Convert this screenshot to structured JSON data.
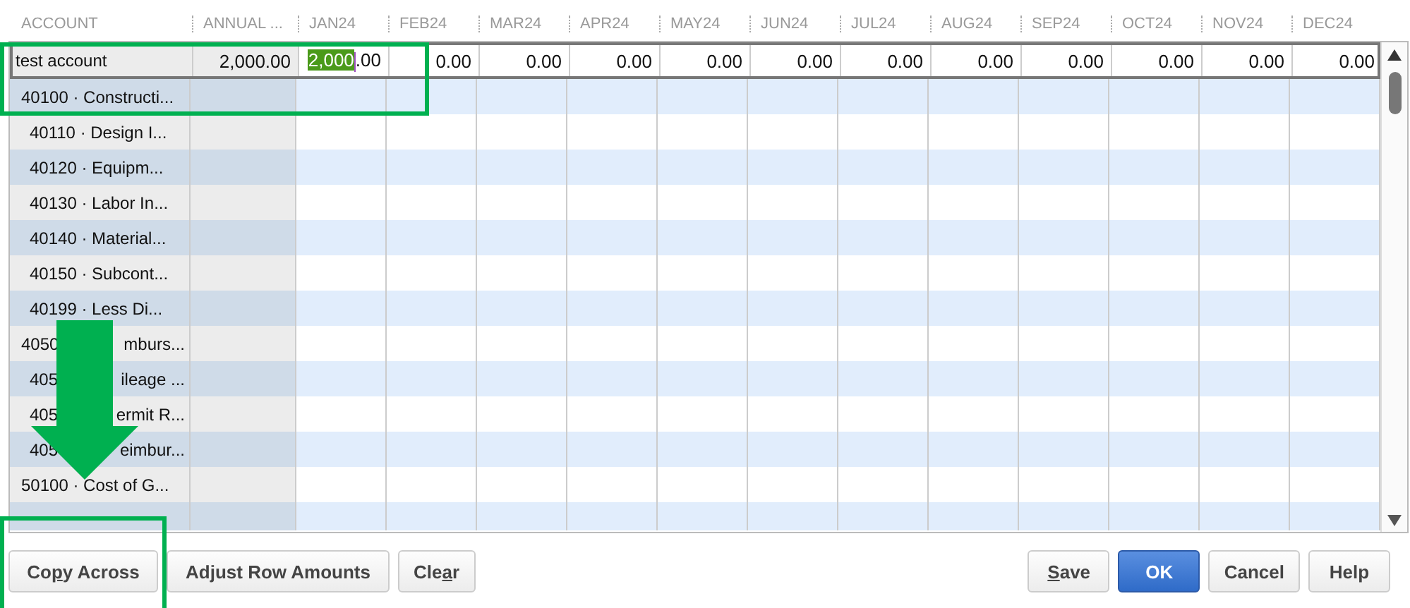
{
  "columns": [
    "ACCOUNT",
    "ANNUAL ...",
    "JAN24",
    "FEB24",
    "MAR24",
    "APR24",
    "MAY24",
    "JUN24",
    "JUL24",
    "AUG24",
    "SEP24",
    "OCT24",
    "NOV24",
    "DEC24"
  ],
  "entry_row": {
    "account": "test account",
    "annual": "2,000.00",
    "months": [
      {
        "highlighted": "2,000",
        "value": ".00"
      },
      {
        "value": "0.00"
      },
      {
        "value": "0.00"
      },
      {
        "value": "0.00"
      },
      {
        "value": "0.00"
      },
      {
        "value": "0.00"
      },
      {
        "value": "0.00"
      },
      {
        "value": "0.00"
      },
      {
        "value": "0.00"
      },
      {
        "value": "0.00"
      },
      {
        "value": "0.00"
      },
      {
        "value": "0.00"
      }
    ]
  },
  "accounts": [
    {
      "account": [
        "40100 · Constructi..."
      ],
      "children": [
        {
          "account": [
            "40110 · Design I..."
          ]
        },
        {
          "account": [
            "40120 · Equipm..."
          ]
        },
        {
          "account": [
            "40130 · Labor In..."
          ]
        },
        {
          "account": [
            "40140 · Material..."
          ]
        },
        {
          "account": [
            "40150 · Subcont..."
          ]
        },
        {
          "account": [
            "40199 · Less Di..."
          ]
        }
      ]
    },
    {
      "account": [
        "4050",
        "mburs..."
      ],
      "children": [
        {
          "account": [
            "405",
            "ileage ..."
          ]
        },
        {
          "account": [
            "405",
            "ermit R..."
          ]
        },
        {
          "account": [
            "405",
            "eimbur..."
          ]
        }
      ]
    },
    {
      "account": [
        "50100 · Cost of G..."
      ]
    }
  ],
  "buttons_left": [
    {
      "before": "Co",
      "key": "p",
      "after": "y Across"
    },
    {
      "before": "Adjust Row Amounts"
    },
    {
      "before": "Cle",
      "key": "a",
      "after": "r"
    }
  ],
  "buttons_right": [
    {
      "key": "S",
      "after": "ave",
      "kind": "normal"
    },
    {
      "before": "OK",
      "kind": "primary"
    },
    {
      "before": "Cancel",
      "kind": "normal"
    },
    {
      "before": "Help",
      "kind": "normal"
    }
  ]
}
